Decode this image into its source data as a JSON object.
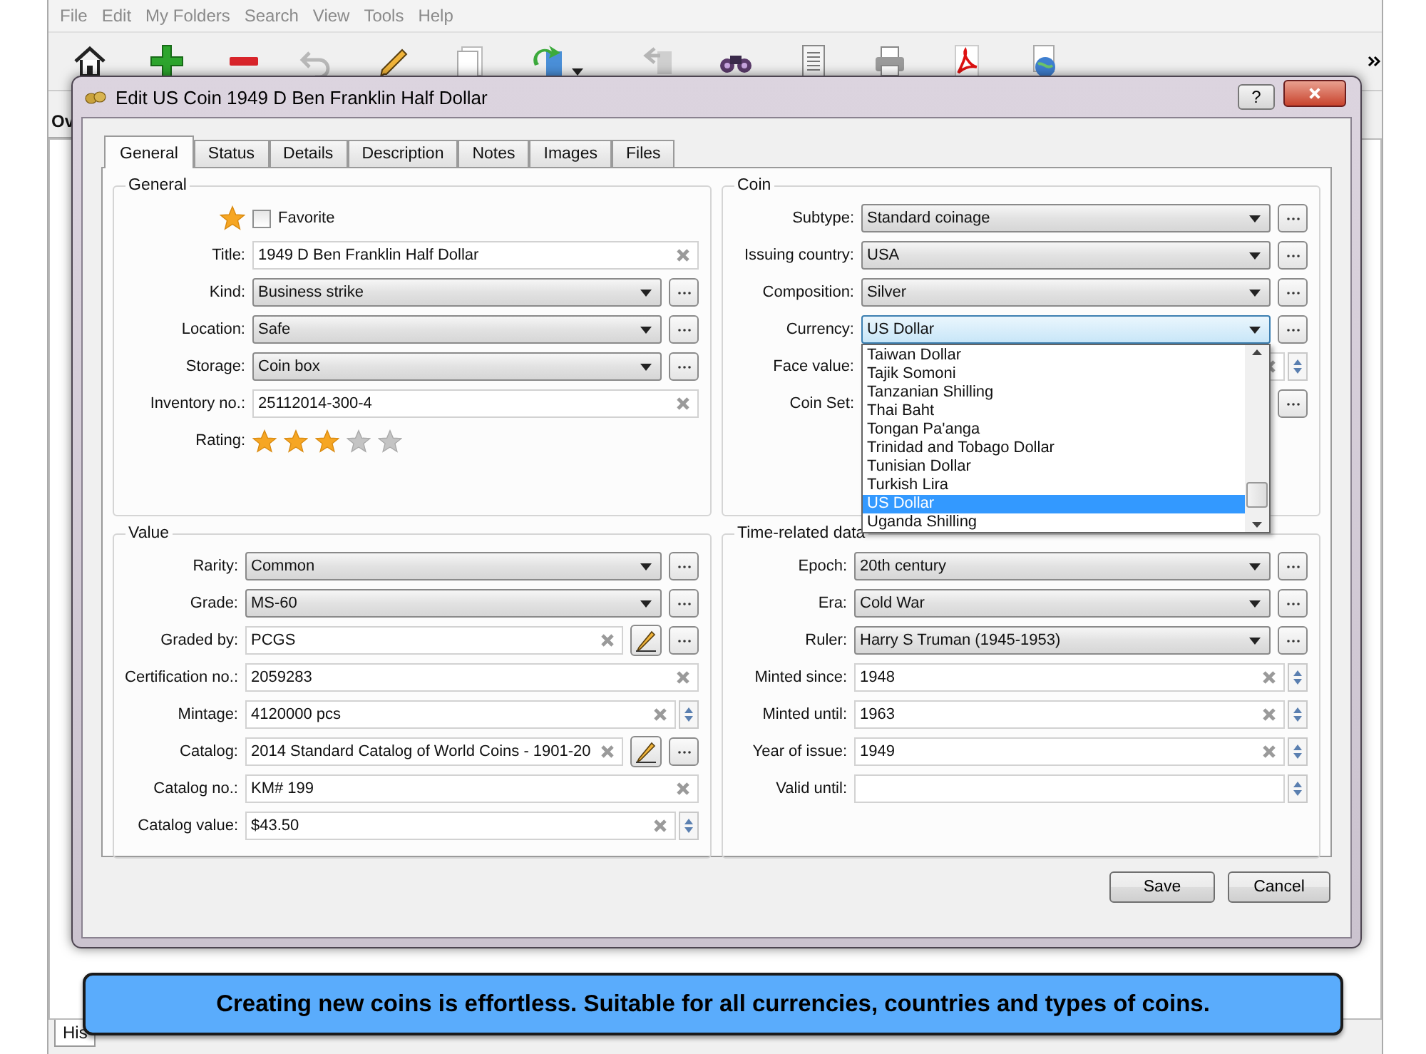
{
  "menu": [
    "File",
    "Edit",
    "My Folders",
    "Search",
    "View",
    "Tools",
    "Help"
  ],
  "background": {
    "pane_tab": "Ov",
    "bottom_tab": "His"
  },
  "dialog": {
    "title": "Edit US Coin 1949 D Ben Franklin Half Dollar",
    "help_button": "?",
    "tabs": [
      {
        "label": "General",
        "selected": true
      },
      {
        "label": "Status",
        "selected": false
      },
      {
        "label": "Details",
        "selected": false
      },
      {
        "label": "Description",
        "selected": false
      },
      {
        "label": "Notes",
        "selected": false
      },
      {
        "label": "Images",
        "selected": false
      },
      {
        "label": "Files",
        "selected": false
      }
    ],
    "groups": [
      {
        "title": "General",
        "rows": [
          {
            "kind": "favorite",
            "label": "Favorite",
            "checked": false
          },
          {
            "kind": "text",
            "label": "Title:",
            "value": "1949 D Ben Franklin Half Dollar"
          },
          {
            "kind": "combo",
            "label": "Kind:",
            "value": "Business strike",
            "open": false
          },
          {
            "kind": "combo",
            "label": "Location:",
            "value": "Safe",
            "open": false
          },
          {
            "kind": "combo",
            "label": "Storage:",
            "value": "Coin box",
            "open": false
          },
          {
            "kind": "text",
            "label": "Inventory no.:",
            "value": "25112014-300-4"
          },
          {
            "kind": "rating",
            "label": "Rating:",
            "stars": 3
          }
        ]
      },
      {
        "title": "Coin",
        "rows": [
          {
            "kind": "combo",
            "label": "Subtype:",
            "value": "Standard coinage",
            "open": false
          },
          {
            "kind": "combo",
            "label": "Issuing country:",
            "value": "USA",
            "open": false
          },
          {
            "kind": "combo",
            "label": "Composition:",
            "value": "Silver",
            "open": false
          },
          {
            "kind": "combo",
            "label": "Currency:",
            "value": "US Dollar",
            "open": true,
            "options": [
              {
                "label": "Taiwan Dollar",
                "selected": false
              },
              {
                "label": "Tajik Somoni",
                "selected": false
              },
              {
                "label": "Tanzanian Shilling",
                "selected": false
              },
              {
                "label": "Thai Baht",
                "selected": false
              },
              {
                "label": "Tongan Pa'anga",
                "selected": false
              },
              {
                "label": "Trinidad and Tobago Dollar",
                "selected": false
              },
              {
                "label": "Tunisian Dollar",
                "selected": false
              },
              {
                "label": "Turkish Lira",
                "selected": false
              },
              {
                "label": "US Dollar",
                "selected": true
              },
              {
                "label": "Uganda Shilling",
                "selected": false
              }
            ]
          },
          {
            "kind": "spin",
            "label": "Face value:",
            "clearable": true
          },
          {
            "kind": "combo",
            "label": "Coin Set:"
          }
        ]
      },
      {
        "title": "Value",
        "rows": [
          {
            "kind": "combo",
            "label": "Rarity:",
            "value": "Common",
            "open": false
          },
          {
            "kind": "combo",
            "label": "Grade:",
            "value": "MS-60",
            "open": false
          },
          {
            "kind": "lookup",
            "label": "Graded by:",
            "value": "PCGS"
          },
          {
            "kind": "text",
            "label": "Certification no.:",
            "value": "2059283"
          },
          {
            "kind": "spin",
            "label": "Mintage:",
            "value": "4120000 pcs",
            "clearable": true
          },
          {
            "kind": "lookup",
            "label": "Catalog:",
            "value": "2014 Standard Catalog of World Coins - 1901-20"
          },
          {
            "kind": "text",
            "label": "Catalog no.:",
            "value": "KM# 199"
          },
          {
            "kind": "spin",
            "label": "Catalog value:",
            "value": "$43.50",
            "clearable": true
          }
        ]
      },
      {
        "title": "Time-related data",
        "rows": [
          {
            "kind": "combo",
            "label": "Epoch:",
            "value": "20th century",
            "open": false
          },
          {
            "kind": "combo",
            "label": "Era:",
            "value": "Cold War",
            "open": false
          },
          {
            "kind": "combo",
            "label": "Ruler:",
            "value": "Harry S Truman (1945-1953)",
            "open": false
          },
          {
            "kind": "spin",
            "label": "Minted since:",
            "value": "1948",
            "clearable": true
          },
          {
            "kind": "spin",
            "label": "Minted until:",
            "value": "1963",
            "clearable": true
          },
          {
            "kind": "spin",
            "label": "Year of issue:",
            "value": "1949",
            "clearable": true
          },
          {
            "kind": "spin",
            "label": "Valid until:",
            "clearable": false
          }
        ]
      }
    ],
    "buttons": [
      "Save",
      "Cancel"
    ]
  },
  "banner": "Creating new coins is effortless. Suitable for all currencies, countries and types of coins."
}
